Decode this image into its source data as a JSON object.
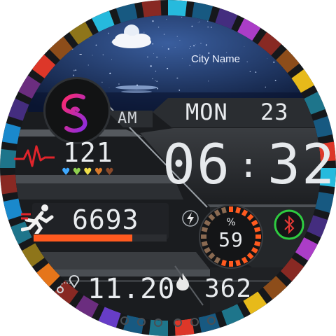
{
  "weather": {
    "location": "City Name",
    "temperature": "-",
    "condition_icon": "moon-cloud-icon"
  },
  "app_icon": "spiral-s-icon",
  "ampm": "AM",
  "date": {
    "weekday": "MON",
    "day": "23"
  },
  "time": {
    "hours": "06",
    "separator": ":",
    "minutes": "32"
  },
  "heart_rate": {
    "value": "121",
    "icon": "heartbeat-icon",
    "zone_hearts": [
      "#3fa9ff",
      "#8fd14f",
      "#f1e04a",
      "#d97a2b",
      "#8a4a2a"
    ]
  },
  "steps": {
    "value": "6693",
    "icon": "runner-icon",
    "progress": 0.74,
    "bar_color": "#ff5a1f"
  },
  "battery": {
    "value": "59",
    "unit": "%",
    "icon": "charging-bolt-icon",
    "level": 0.59
  },
  "bluetooth": {
    "icon": "bluetooth-icon",
    "status_color": "#e53935",
    "ring_color": "#2ecc40"
  },
  "distance": {
    "value": "11.20",
    "icon": "route-icon"
  },
  "calories": {
    "value": "362",
    "icon": "flame-icon"
  },
  "colors": {
    "accent": "#ff5a1f",
    "bezel_cool": "#27c3e8",
    "bezel_warm": "#e8392a"
  }
}
